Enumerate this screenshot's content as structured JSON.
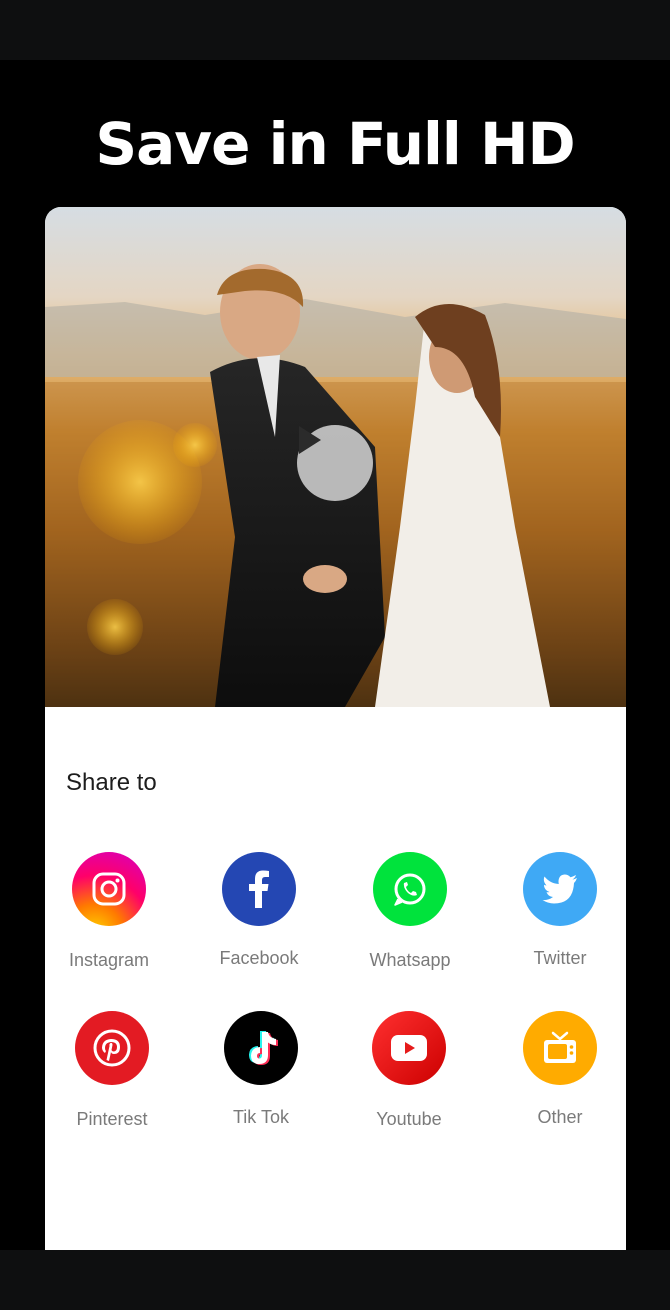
{
  "headline": "Save in Full HD",
  "share": {
    "title": "Share to",
    "items": [
      {
        "label": "Instagram",
        "icon": "instagram-icon",
        "color": "#e1306c"
      },
      {
        "label": "Facebook",
        "icon": "facebook-icon",
        "color": "#2447b3"
      },
      {
        "label": "Whatsapp",
        "icon": "whatsapp-icon",
        "color": "#00e33c"
      },
      {
        "label": "Twitter",
        "icon": "twitter-icon",
        "color": "#3fa9f5"
      },
      {
        "label": "Pinterest",
        "icon": "pinterest-icon",
        "color": "#e31b23"
      },
      {
        "label": "Tik Tok",
        "icon": "tiktok-icon",
        "color": "#000000"
      },
      {
        "label": "Youtube",
        "icon": "youtube-icon",
        "color": "#e61a1a"
      },
      {
        "label": "Other",
        "icon": "tv-icon",
        "color": "#ffab00"
      }
    ]
  }
}
